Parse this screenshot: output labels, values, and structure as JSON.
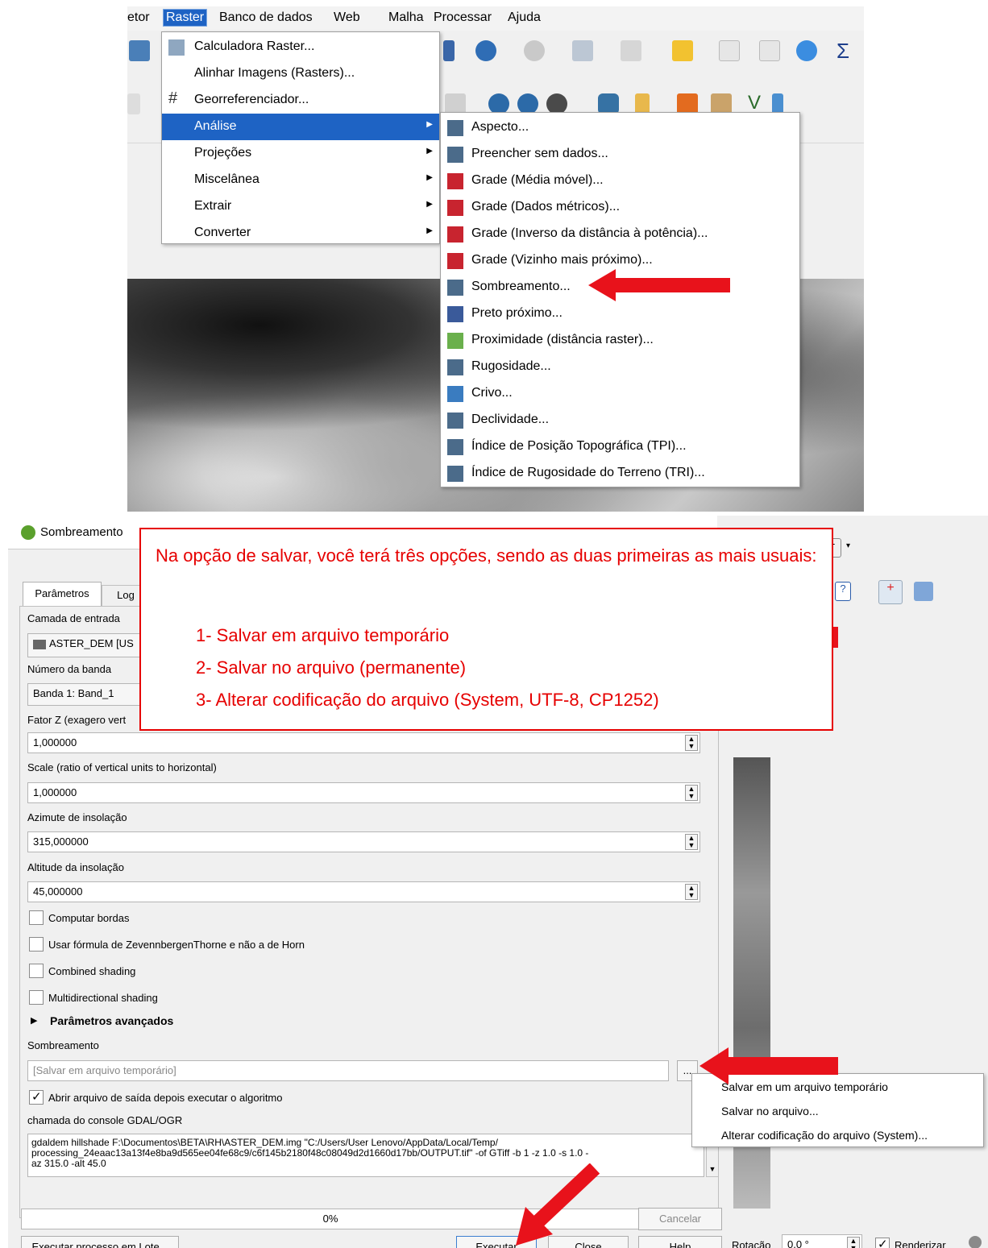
{
  "menubar": {
    "items": [
      "etor",
      "Raster",
      "Banco de dados",
      "Web",
      "Malha",
      "Processar",
      "Ajuda"
    ]
  },
  "raster_menu": {
    "items": [
      {
        "label": "Calculadora Raster..."
      },
      {
        "label": "Alinhar Imagens (Rasters)..."
      },
      {
        "label": "Georreferenciador..."
      },
      {
        "label": "Análise"
      },
      {
        "label": "Projeções"
      },
      {
        "label": "Miscelânea"
      },
      {
        "label": "Extrair"
      },
      {
        "label": "Converter"
      }
    ]
  },
  "analysis_submenu": {
    "items": [
      "Aspecto...",
      "Preencher sem dados...",
      "Grade (Média móvel)...",
      "Grade (Dados métricos)...",
      "Grade (Inverso da distância à potência)...",
      "Grade (Vizinho mais próximo)...",
      "Sombreamento...",
      "Preto próximo...",
      "Proximidade (distância raster)...",
      "Rugosidade...",
      "Crivo...",
      "Declividade...",
      "Índice de Posição Topográfica (TPI)...",
      "Índice de Rugosidade do Terreno (TRI)..."
    ]
  },
  "dialog": {
    "title": "Sombreamento",
    "tabs": [
      "Parâmetros",
      "Log"
    ],
    "input_layer_label": "Camada de entrada",
    "input_layer_value": "ASTER_DEM [US",
    "band_label": "Número da banda",
    "band_value": "Banda 1: Band_1",
    "zfactor_label": "Fator Z (exagero vert",
    "zfactor_value": "1,000000",
    "scale_label": "Scale (ratio of vertical units to horizontal)",
    "scale_value": "1,000000",
    "azimuth_label": "Azimute de insolação",
    "azimuth_value": "315,000000",
    "altitude_label": "Altitude da insolação",
    "altitude_value": "45,000000",
    "checkboxes": [
      {
        "label": "Computar bordas"
      },
      {
        "label": "Usar fórmula de ZevennbergenThorne e não a de Horn"
      },
      {
        "label": "Combined shading"
      },
      {
        "label": "Multidirectional shading"
      }
    ],
    "advanced_label": "Parâmetros avançados",
    "output_label": "Sombreamento",
    "output_placeholder": "[Salvar em arquivo temporário]",
    "browse_label": "...",
    "open_output_label": "Abrir arquivo de saída depois executar o algoritmo",
    "console_label": "chamada do console GDAL/OGR",
    "console_lines": [
      "gdaldem hillshade F:\\Documentos\\BETA\\RH\\ASTER_DEM.img \"C:/Users/User Lenovo/AppData/Local/Temp/",
      "processing_24eaac13a13f4e8ba9d565ee04fe68c9/c6f145b2180f48c08049d2d1660d17bb/OUTPUT.tif\" -of GTiff -b 1 -z 1.0 -s 1.0 -",
      "az 315.0 -alt 45.0"
    ],
    "progress_text": "0%",
    "cancel_label": "Cancelar",
    "batch_label": "Executar processo em Lote...",
    "run_label": "Executar",
    "close_label": "Close",
    "help_label": "Help"
  },
  "save_menu": {
    "items": [
      "Salvar em um arquivo temporário",
      "Salvar no arquivo...",
      "Alterar codificação do arquivo (System)..."
    ]
  },
  "statusbar": {
    "rotation_label": "Rotação",
    "rotation_value": "0,0 °",
    "render_label": "Renderizar"
  },
  "annotation": {
    "intro": "Na opção de salvar, você terá três opções, sendo as duas primeiras as mais usuais:",
    "items": [
      "1-   Salvar em arquivo temporário",
      "2-   Salvar no arquivo (permanente)",
      "3-   Alterar codificação do arquivo (System, UTF-8, CP1252)"
    ]
  },
  "colors": {
    "highlight": "#1e63c4",
    "annotation_red": "#e60000",
    "arrow_red": "#e8121b"
  }
}
